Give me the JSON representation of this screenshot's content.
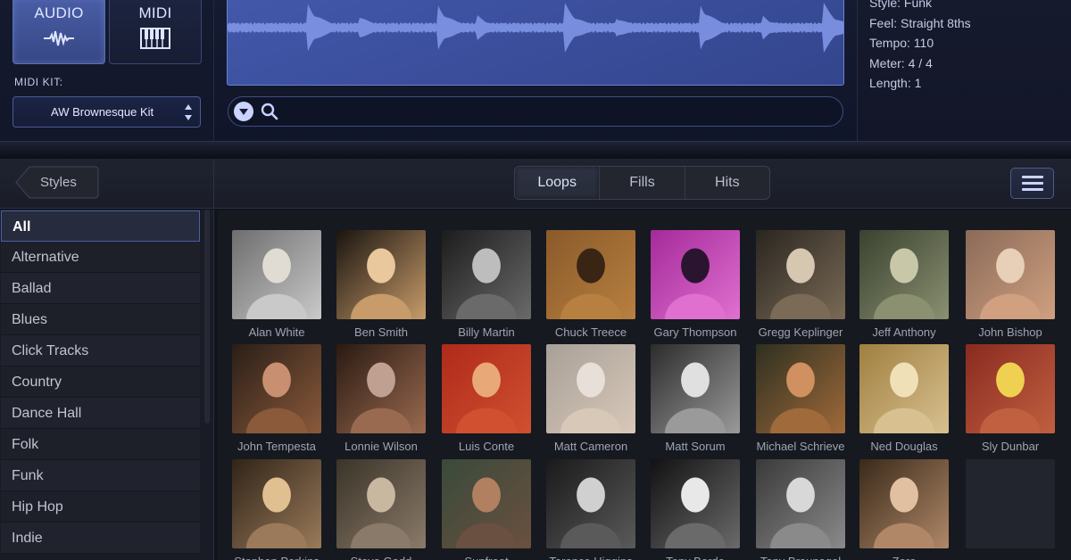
{
  "source": {
    "audio_label": "AUDIO",
    "midi_label": "MIDI"
  },
  "midi_kit": {
    "label": "MIDI KIT:",
    "value": "AW Brownesque Kit"
  },
  "search": {
    "placeholder": ""
  },
  "info": {
    "style": "Style: Funk",
    "feel": "Feel: Straight 8ths",
    "tempo": "Tempo: 110",
    "meter": "Meter: 4 / 4",
    "length": "Length: 1"
  },
  "nav": {
    "back_label": "Styles"
  },
  "tabs": [
    {
      "label": "Loops",
      "active": true
    },
    {
      "label": "Fills",
      "active": false
    },
    {
      "label": "Hits",
      "active": false
    }
  ],
  "styles": [
    "All",
    "Alternative",
    "Ballad",
    "Blues",
    "Click Tracks",
    "Country",
    "Dance Hall",
    "Folk",
    "Funk",
    "Hip Hop",
    "Indie"
  ],
  "selected_style": "All",
  "drummers": [
    "Alan White",
    "Ben Smith",
    "Billy Martin",
    "Chuck Treece",
    "Gary Thompson",
    "Gregg Keplinger",
    "Jeff Anthony",
    "John Bishop",
    "John Tempesta",
    "Lonnie Wilson",
    "Luis Conte",
    "Matt Cameron",
    "Matt Sorum",
    "Michael Schrieve",
    "Ned Douglas",
    "Sly Dunbar",
    "Stephen Perkins",
    "Steve Gadd",
    "Sunfreet",
    "Terence Higgins",
    "Tony Bordo",
    "Tony Braunagel",
    "Zoro"
  ],
  "colors": {
    "accent": "#4a5ea7",
    "waveform": "#7f95e6",
    "background": "#16191f"
  }
}
